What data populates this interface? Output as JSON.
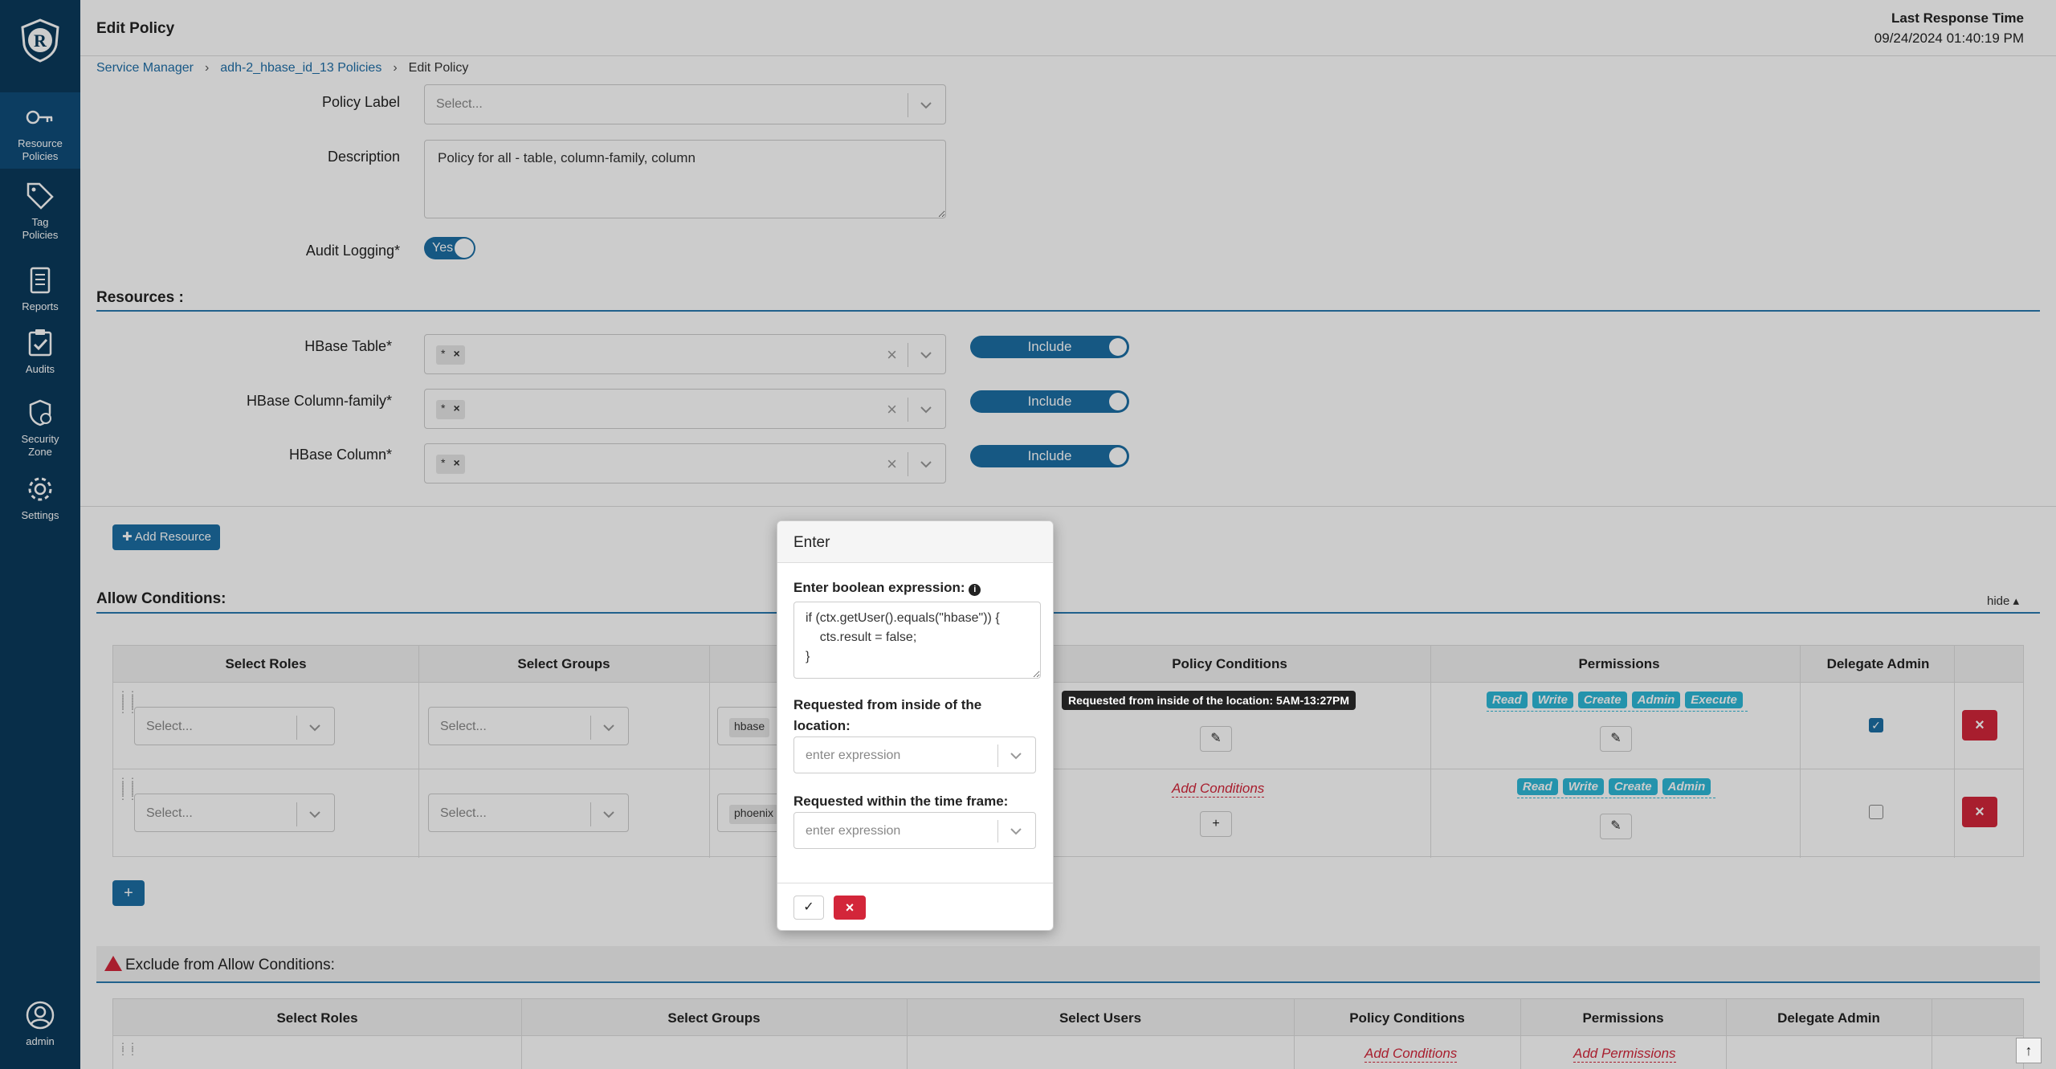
{
  "header": {
    "title": "Edit Policy",
    "last_response_label": "Last Response Time",
    "last_response_value": "09/24/2024 01:40:19 PM"
  },
  "breadcrumb": {
    "items": [
      "Service Manager",
      "adh-2_hbase_id_13 Policies",
      "Edit Policy"
    ]
  },
  "sidebar": {
    "items": [
      {
        "label1": "Resource",
        "label2": "Policies"
      },
      {
        "label1": "Tag",
        "label2": "Policies"
      },
      {
        "label1": "Reports",
        "label2": ""
      },
      {
        "label1": "Audits",
        "label2": ""
      },
      {
        "label1": "Security",
        "label2": "Zone"
      },
      {
        "label1": "Settings",
        "label2": ""
      }
    ],
    "user": "admin"
  },
  "form": {
    "policy_label": "Policy Label",
    "policy_label_placeholder": "Select...",
    "description_label": "Description",
    "description_value": "Policy for all - table, column-family, column",
    "audit_label": "Audit Logging*",
    "audit_value": "Yes"
  },
  "resources": {
    "title": "Resources :",
    "rows": [
      {
        "label": "HBase Table*",
        "tag": "*",
        "toggle": "Include"
      },
      {
        "label": "HBase Column-family*",
        "tag": "*",
        "toggle": "Include"
      },
      {
        "label": "HBase Column*",
        "tag": "*",
        "toggle": "Include"
      }
    ],
    "add_button": "Add Resource"
  },
  "allow": {
    "title": "Allow Conditions:",
    "hide": "hide",
    "columns": [
      "Select Roles",
      "Select Groups",
      "Policy Conditions",
      "Permissions",
      "Delegate Admin"
    ],
    "select_placeholder": "Select...",
    "rows": [
      {
        "user": "hbase",
        "perms": [
          "Read",
          "Write",
          "Create",
          "Admin",
          "Execute"
        ],
        "delegate": true
      },
      {
        "user": "phoenix",
        "add_conditions": "Add Conditions",
        "perms": [
          "Read",
          "Write",
          "Create",
          "Admin"
        ],
        "delegate": false
      }
    ]
  },
  "exclude": {
    "title": "Exclude from Allow Conditions:",
    "columns": [
      "Select Roles",
      "Select Groups",
      "Select Users",
      "Policy Conditions",
      "Permissions",
      "Delegate Admin"
    ],
    "add_conditions": "Add Conditions",
    "add_permissions": "Add Permissions"
  },
  "popover": {
    "title": "Enter",
    "bool_label": "Enter boolean expression:",
    "bool_value": "if (ctx.getUser().equals(\"hbase\")) {\n    cts.result = false;\n}",
    "location_label": "Requested from inside of the location:",
    "location_placeholder": "enter expression",
    "time_label": "Requested within the time frame:",
    "time_placeholder": "enter expression"
  },
  "tooltip": "Requested from inside of the location: 5AM-13:27PM"
}
